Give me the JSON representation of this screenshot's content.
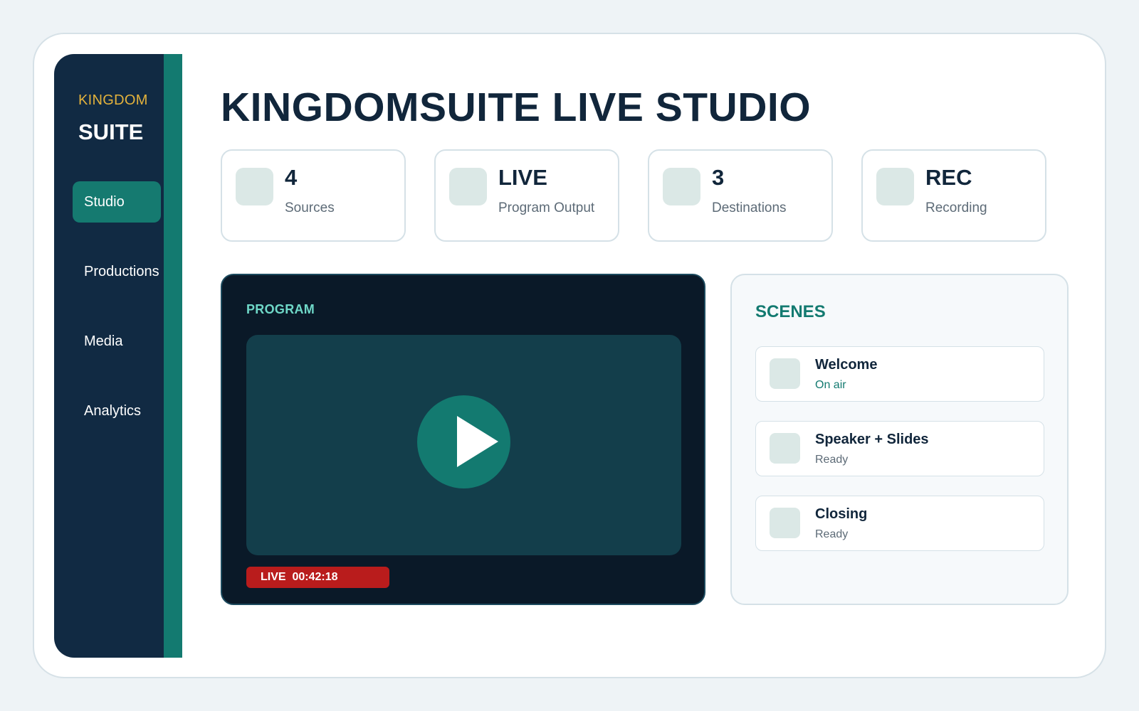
{
  "brand": {
    "top": "KINGDOM",
    "bottom": "SUITE"
  },
  "nav": [
    {
      "label": "Studio",
      "active": true
    },
    {
      "label": "Productions",
      "active": false
    },
    {
      "label": "Media",
      "active": false
    },
    {
      "label": "Analytics",
      "active": false
    }
  ],
  "page_title": "KINGDOMSUITE LIVE STUDIO",
  "stats": [
    {
      "value": "4",
      "label": "Sources"
    },
    {
      "value": "LIVE",
      "label": "Program Output"
    },
    {
      "value": "3",
      "label": "Destinations"
    },
    {
      "value": "REC",
      "label": "Recording"
    }
  ],
  "program": {
    "label": "PROGRAM",
    "live_tag": "LIVE  00:42:18"
  },
  "scenes": {
    "title": "SCENES",
    "items": [
      {
        "name": "Welcome",
        "status": "On air"
      },
      {
        "name": "Speaker + Slides",
        "status": "Ready"
      },
      {
        "name": "Closing",
        "status": "Ready"
      }
    ]
  },
  "colors": {
    "sidebar": "#112a43",
    "accent": "#137a70",
    "brand_gold": "#e3b23c",
    "live_red": "#b91c1c",
    "program_bg": "#0a1928"
  },
  "icons": {
    "play": "play-icon"
  }
}
